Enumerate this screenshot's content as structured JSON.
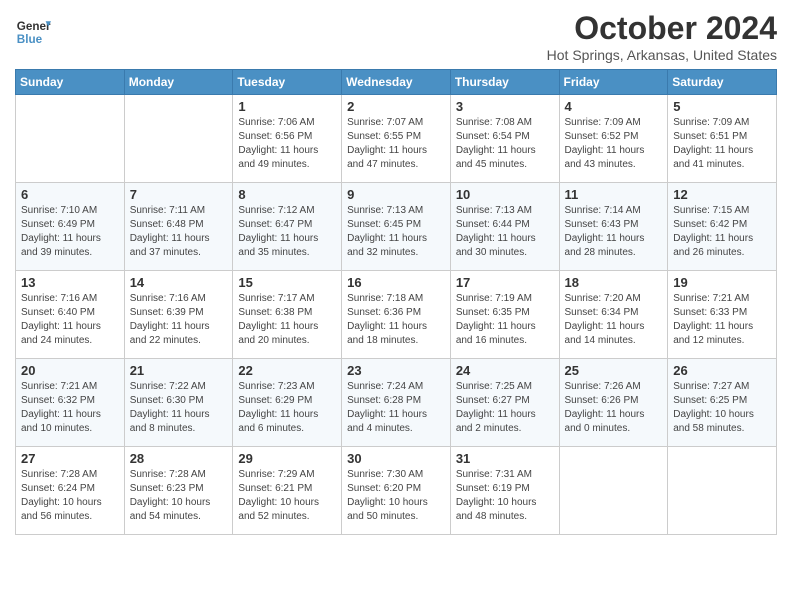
{
  "header": {
    "logo_line1": "General",
    "logo_line2": "Blue",
    "month_title": "October 2024",
    "location": "Hot Springs, Arkansas, United States"
  },
  "days_of_week": [
    "Sunday",
    "Monday",
    "Tuesday",
    "Wednesday",
    "Thursday",
    "Friday",
    "Saturday"
  ],
  "weeks": [
    [
      {
        "day": "",
        "info": ""
      },
      {
        "day": "",
        "info": ""
      },
      {
        "day": "1",
        "info": "Sunrise: 7:06 AM\nSunset: 6:56 PM\nDaylight: 11 hours and 49 minutes."
      },
      {
        "day": "2",
        "info": "Sunrise: 7:07 AM\nSunset: 6:55 PM\nDaylight: 11 hours and 47 minutes."
      },
      {
        "day": "3",
        "info": "Sunrise: 7:08 AM\nSunset: 6:54 PM\nDaylight: 11 hours and 45 minutes."
      },
      {
        "day": "4",
        "info": "Sunrise: 7:09 AM\nSunset: 6:52 PM\nDaylight: 11 hours and 43 minutes."
      },
      {
        "day": "5",
        "info": "Sunrise: 7:09 AM\nSunset: 6:51 PM\nDaylight: 11 hours and 41 minutes."
      }
    ],
    [
      {
        "day": "6",
        "info": "Sunrise: 7:10 AM\nSunset: 6:49 PM\nDaylight: 11 hours and 39 minutes."
      },
      {
        "day": "7",
        "info": "Sunrise: 7:11 AM\nSunset: 6:48 PM\nDaylight: 11 hours and 37 minutes."
      },
      {
        "day": "8",
        "info": "Sunrise: 7:12 AM\nSunset: 6:47 PM\nDaylight: 11 hours and 35 minutes."
      },
      {
        "day": "9",
        "info": "Sunrise: 7:13 AM\nSunset: 6:45 PM\nDaylight: 11 hours and 32 minutes."
      },
      {
        "day": "10",
        "info": "Sunrise: 7:13 AM\nSunset: 6:44 PM\nDaylight: 11 hours and 30 minutes."
      },
      {
        "day": "11",
        "info": "Sunrise: 7:14 AM\nSunset: 6:43 PM\nDaylight: 11 hours and 28 minutes."
      },
      {
        "day": "12",
        "info": "Sunrise: 7:15 AM\nSunset: 6:42 PM\nDaylight: 11 hours and 26 minutes."
      }
    ],
    [
      {
        "day": "13",
        "info": "Sunrise: 7:16 AM\nSunset: 6:40 PM\nDaylight: 11 hours and 24 minutes."
      },
      {
        "day": "14",
        "info": "Sunrise: 7:16 AM\nSunset: 6:39 PM\nDaylight: 11 hours and 22 minutes."
      },
      {
        "day": "15",
        "info": "Sunrise: 7:17 AM\nSunset: 6:38 PM\nDaylight: 11 hours and 20 minutes."
      },
      {
        "day": "16",
        "info": "Sunrise: 7:18 AM\nSunset: 6:36 PM\nDaylight: 11 hours and 18 minutes."
      },
      {
        "day": "17",
        "info": "Sunrise: 7:19 AM\nSunset: 6:35 PM\nDaylight: 11 hours and 16 minutes."
      },
      {
        "day": "18",
        "info": "Sunrise: 7:20 AM\nSunset: 6:34 PM\nDaylight: 11 hours and 14 minutes."
      },
      {
        "day": "19",
        "info": "Sunrise: 7:21 AM\nSunset: 6:33 PM\nDaylight: 11 hours and 12 minutes."
      }
    ],
    [
      {
        "day": "20",
        "info": "Sunrise: 7:21 AM\nSunset: 6:32 PM\nDaylight: 11 hours and 10 minutes."
      },
      {
        "day": "21",
        "info": "Sunrise: 7:22 AM\nSunset: 6:30 PM\nDaylight: 11 hours and 8 minutes."
      },
      {
        "day": "22",
        "info": "Sunrise: 7:23 AM\nSunset: 6:29 PM\nDaylight: 11 hours and 6 minutes."
      },
      {
        "day": "23",
        "info": "Sunrise: 7:24 AM\nSunset: 6:28 PM\nDaylight: 11 hours and 4 minutes."
      },
      {
        "day": "24",
        "info": "Sunrise: 7:25 AM\nSunset: 6:27 PM\nDaylight: 11 hours and 2 minutes."
      },
      {
        "day": "25",
        "info": "Sunrise: 7:26 AM\nSunset: 6:26 PM\nDaylight: 11 hours and 0 minutes."
      },
      {
        "day": "26",
        "info": "Sunrise: 7:27 AM\nSunset: 6:25 PM\nDaylight: 10 hours and 58 minutes."
      }
    ],
    [
      {
        "day": "27",
        "info": "Sunrise: 7:28 AM\nSunset: 6:24 PM\nDaylight: 10 hours and 56 minutes."
      },
      {
        "day": "28",
        "info": "Sunrise: 7:28 AM\nSunset: 6:23 PM\nDaylight: 10 hours and 54 minutes."
      },
      {
        "day": "29",
        "info": "Sunrise: 7:29 AM\nSunset: 6:21 PM\nDaylight: 10 hours and 52 minutes."
      },
      {
        "day": "30",
        "info": "Sunrise: 7:30 AM\nSunset: 6:20 PM\nDaylight: 10 hours and 50 minutes."
      },
      {
        "day": "31",
        "info": "Sunrise: 7:31 AM\nSunset: 6:19 PM\nDaylight: 10 hours and 48 minutes."
      },
      {
        "day": "",
        "info": ""
      },
      {
        "day": "",
        "info": ""
      }
    ]
  ]
}
